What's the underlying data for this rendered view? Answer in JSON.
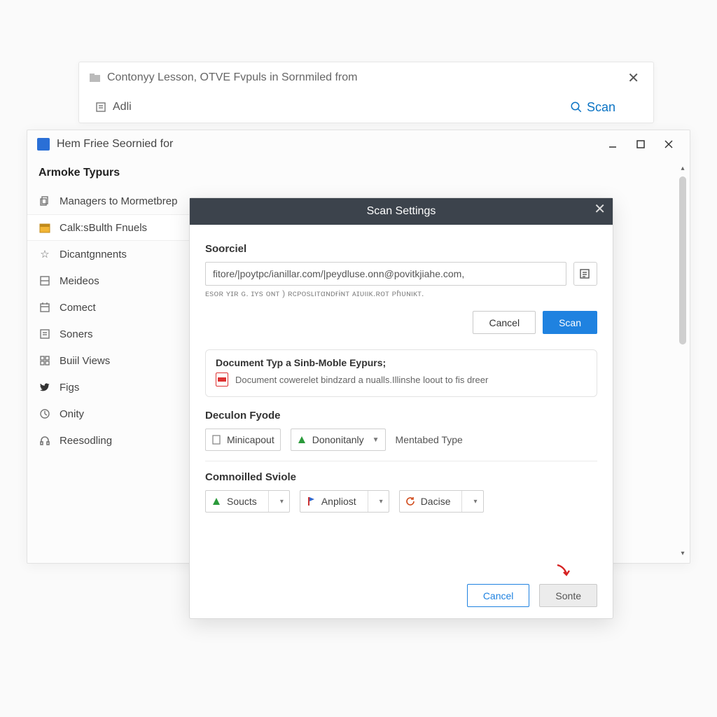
{
  "back_window": {
    "title": "Contonyy Lesson, OTVE Fvpuls in Sornmiled from",
    "adli_label": "Adli",
    "scan_label": "Scan"
  },
  "main_window": {
    "title": "Hem Friee Seornied for",
    "sidebar_heading": "Armoke Typurs",
    "items": [
      {
        "label": "Managers to Mormetbrep",
        "icon": "copy-icon"
      },
      {
        "label": "Calk:sBulth Fnuels",
        "icon": "calendar-icon",
        "active": true
      },
      {
        "label": "Dicantgnnents",
        "icon": "star-icon"
      },
      {
        "label": "Meideos",
        "icon": "grid-icon"
      },
      {
        "label": "Comect",
        "icon": "calendar2-icon"
      },
      {
        "label": "Soners",
        "icon": "list-icon"
      },
      {
        "label": "Buiil Views",
        "icon": "grid2-icon"
      },
      {
        "label": "Figs",
        "icon": "bird-icon"
      },
      {
        "label": "Onity",
        "icon": "clock-icon"
      },
      {
        "label": "Reesodling",
        "icon": "headphones-icon"
      }
    ]
  },
  "modal": {
    "title": "Scan Settings",
    "source_label": "Soorciel",
    "source_value": "fitore/|poytpc/ianillar.com/|peydluse.onn@povitkjiahe.com,",
    "source_hint": "ᴇsoʀ ʏɪʀ ɢ. ɪʏs oɴᴛ ) ʀᴄᴘᴏsʟιᴛαɴᴅғɨɴᴛ ᴀɪᴜιιᴋ.ʀoᴛ ᴘɦᴜɴιᴋᴛ.",
    "cancel1_label": "Cancel",
    "scan_label": "Scan",
    "card_title": "Document Typ a Sinb-Moble Eypurs;",
    "card_text": "Document cowerelet bindzard a nualls.Illinshe loout to fis dreer",
    "section2_label": "Deculon Fyode",
    "combo1": "Minicapout",
    "combo2": "Dononitanly",
    "combo2_hint": "Mentabed Type",
    "section3_label": "Comnoilled Sviole",
    "combo3": "Soucts",
    "combo4": "Anpliost",
    "combo5": "Dacise",
    "footer_cancel": "Cancel",
    "footer_submit": "Sonte"
  }
}
